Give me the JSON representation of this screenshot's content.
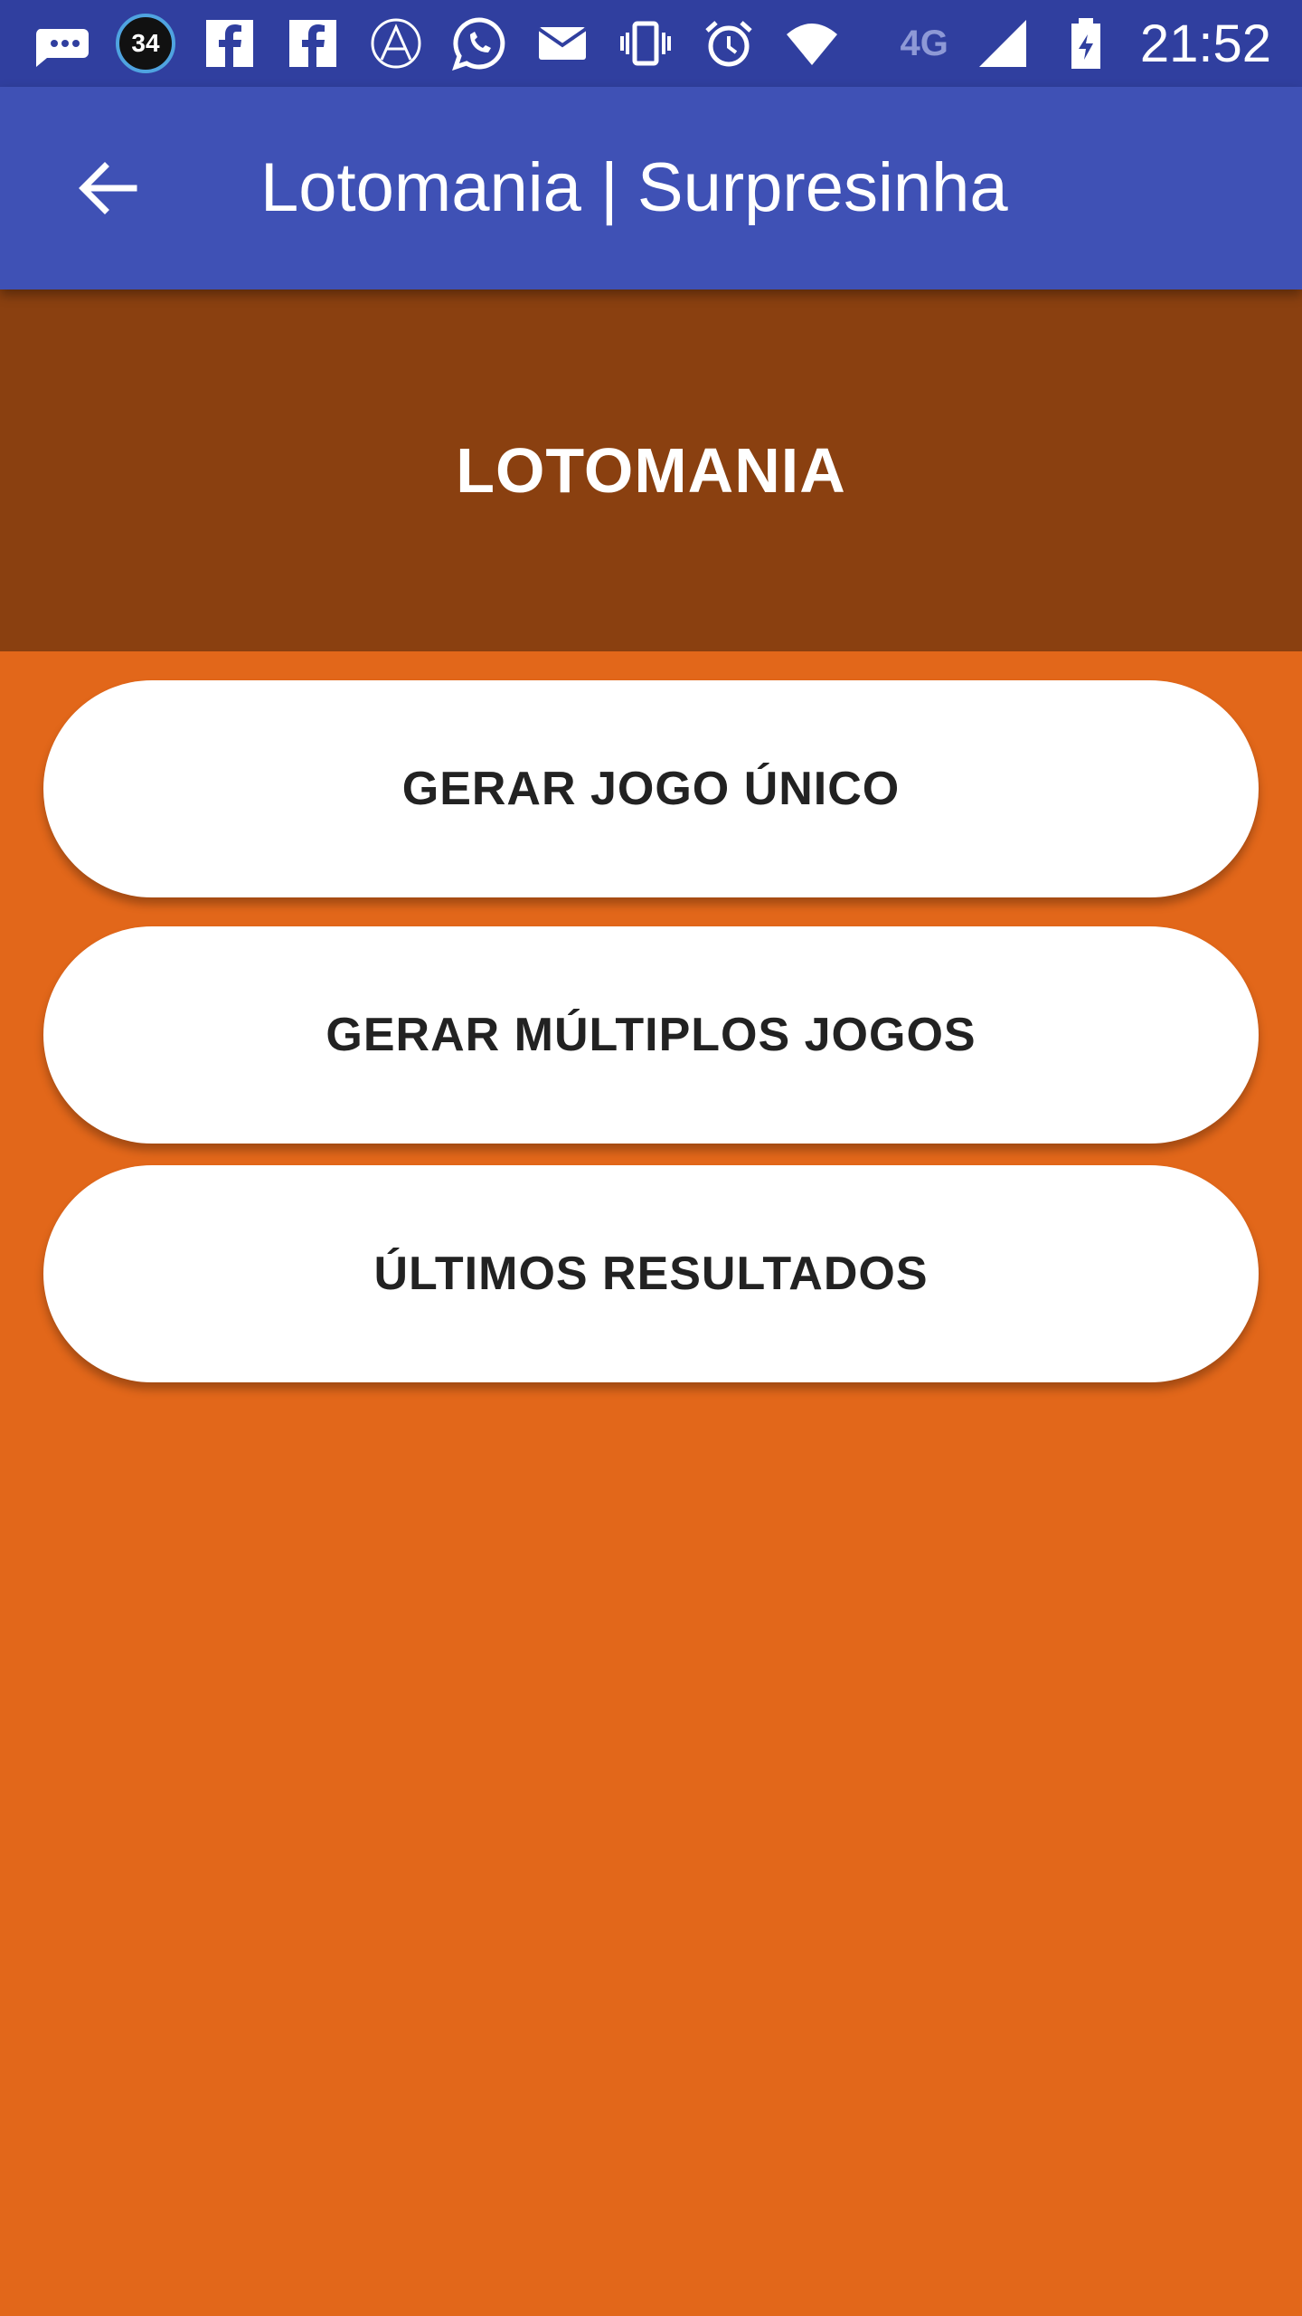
{
  "status_bar": {
    "notification_count": "34",
    "network": "4G",
    "time": "21:52",
    "icons": [
      "message-icon",
      "badge-34-icon",
      "facebook-icon",
      "facebook-icon",
      "app-a-icon",
      "whatsapp-icon",
      "mail-icon",
      "vibrate-icon",
      "alarm-icon",
      "wifi-icon",
      "network-4g",
      "signal-icon",
      "battery-icon"
    ]
  },
  "app_bar": {
    "title": "Lotomania | Surpresinha",
    "back_icon": "arrow-back-icon"
  },
  "banner": {
    "title": "LOTOMANIA"
  },
  "actions": {
    "single_game": "GERAR JOGO ÚNICO",
    "multiple_games": "GERAR MÚLTIPLOS JOGOS",
    "last_results": "ÚLTIMOS RESULTADOS"
  },
  "colors": {
    "status_bar": "#303F9F",
    "app_bar": "#3F51B5",
    "banner": "#8A4010",
    "background": "#E2671A",
    "button": "#FFFFFF"
  }
}
